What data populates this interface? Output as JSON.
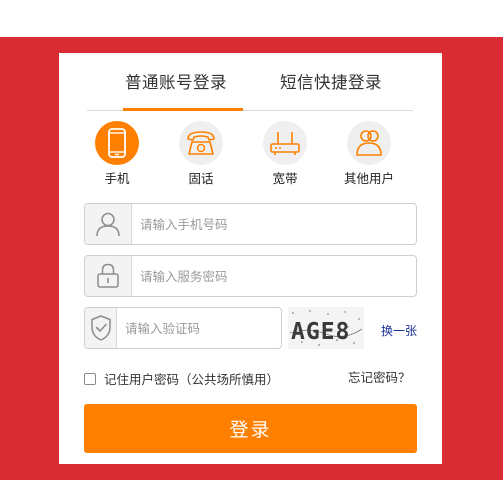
{
  "tabs": [
    {
      "label": "普通账号登录",
      "active": true
    },
    {
      "label": "短信快捷登录",
      "active": false
    }
  ],
  "account_types": [
    {
      "label": "手机",
      "icon": "mobile-phone-icon",
      "active": true
    },
    {
      "label": "固话",
      "icon": "telephone-icon",
      "active": false
    },
    {
      "label": "宽带",
      "icon": "router-icon",
      "active": false
    },
    {
      "label": "其他用户",
      "icon": "users-icon",
      "active": false
    }
  ],
  "phone_input": {
    "placeholder": "请输入手机号码",
    "value": ""
  },
  "password_input": {
    "placeholder": "请输入服务密码",
    "value": ""
  },
  "captcha_input": {
    "placeholder": "请输入验证码",
    "value": ""
  },
  "captcha": {
    "text": "AGE8",
    "refresh_label": "换一张"
  },
  "remember": {
    "label": "记住用户密码（公共场所慎用）",
    "checked": false
  },
  "forgot_label": "忘记密码？",
  "login_label": "登录",
  "colors": {
    "accent": "#ff8000",
    "background": "#da2d33",
    "link": "#1a3399"
  }
}
